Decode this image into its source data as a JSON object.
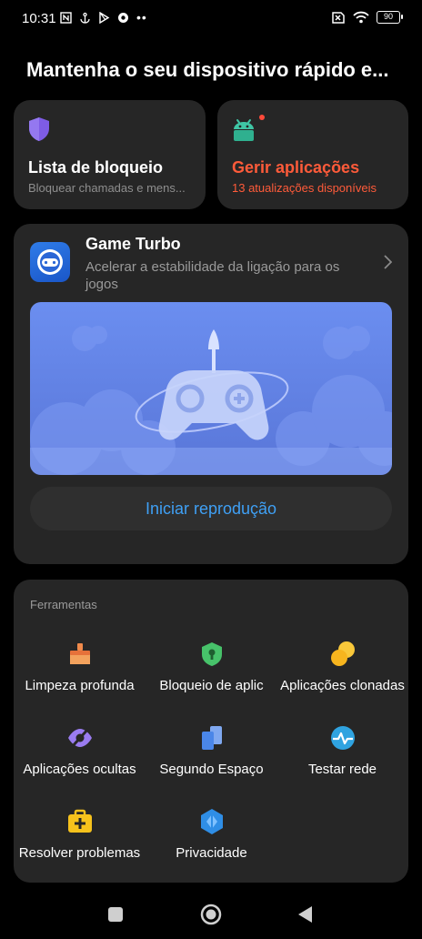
{
  "status_bar": {
    "time": "10:31",
    "battery": "90"
  },
  "page_title": "Mantenha o seu dispositivo rápido e...",
  "block_card": {
    "title": "Lista de bloqueio",
    "subtitle": "Bloquear chamadas e mens..."
  },
  "apps_card": {
    "title": "Gerir aplicações",
    "subtitle": "13 atualizações disponíveis"
  },
  "game_turbo": {
    "title": "Game Turbo",
    "description": "Acelerar a estabilidade da ligação para os jogos",
    "play_label": "Iniciar reprodução"
  },
  "tools": {
    "heading": "Ferramentas",
    "items": [
      {
        "label": "Limpeza profunda",
        "icon": "broom-icon"
      },
      {
        "label": "Bloqueio de aplic",
        "icon": "app-lock-icon"
      },
      {
        "label": "Aplicações clonadas",
        "icon": "dual-apps-icon"
      },
      {
        "label": "Aplicações ocultas",
        "icon": "hidden-apps-icon"
      },
      {
        "label": "Segundo Espaço",
        "icon": "second-space-icon"
      },
      {
        "label": "Testar rede",
        "icon": "network-test-icon"
      },
      {
        "label": "Resolver problemas",
        "icon": "troubleshoot-icon"
      },
      {
        "label": "Privacidade",
        "icon": "privacy-icon"
      }
    ]
  },
  "colors": {
    "accent_red": "#ff5b3a",
    "accent_blue": "#3fa0f5",
    "card_bg": "#262626"
  }
}
